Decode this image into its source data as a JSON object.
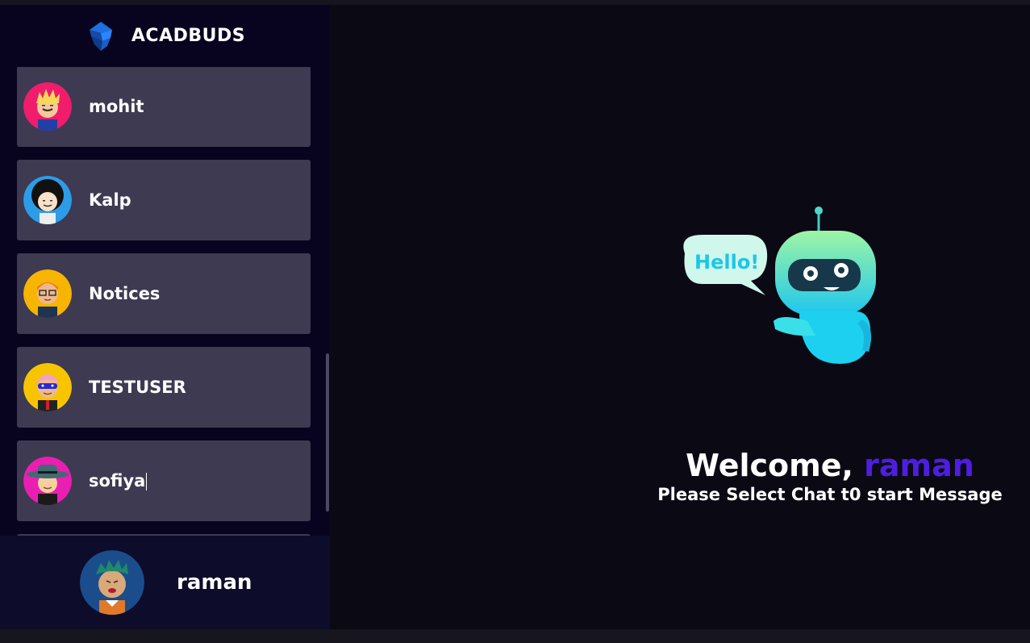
{
  "app": {
    "brand_name": "ACADBUDS",
    "brand_color": "#1b5ec9"
  },
  "sidebar": {
    "contacts": [
      {
        "name": "mohit",
        "avatar": "avatar-blond-mustache",
        "avatar_bg": "#ef1d6b"
      },
      {
        "name": "Kalp",
        "avatar": "avatar-afro",
        "avatar_bg": "#2d9ce8"
      },
      {
        "name": "Notices",
        "avatar": "avatar-glasses",
        "avatar_bg": "#f7b400"
      },
      {
        "name": "TESTUSER",
        "avatar": "avatar-masked",
        "avatar_bg": "#f7c400"
      },
      {
        "name": "sofiya",
        "avatar": "avatar-hat",
        "avatar_bg": "#e81fb0"
      }
    ],
    "current_user": {
      "name": "raman",
      "avatar": "avatar-green-hair",
      "avatar_bg": "#1b4d8c"
    }
  },
  "main": {
    "robot_bubble": "Hello!",
    "welcome_prefix": "Welcome, ",
    "welcome_name": "raman",
    "welcome_sub": "Please Select Chat t0 start Message",
    "accent_color": "#4e1ee0"
  }
}
